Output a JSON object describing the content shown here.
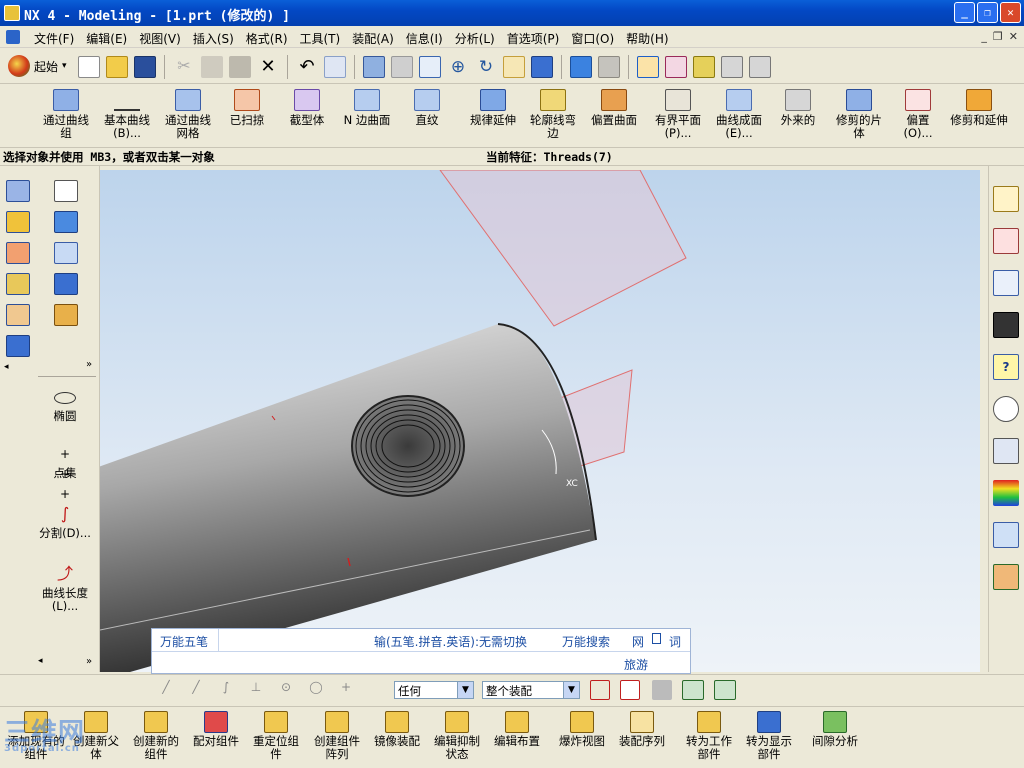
{
  "window": {
    "title": "NX 4 - Modeling - [1.prt  (修改的) ]"
  },
  "menubar": {
    "items": [
      "文件(F)",
      "编辑(E)",
      "视图(V)",
      "插入(S)",
      "格式(R)",
      "工具(T)",
      "装配(A)",
      "信息(I)",
      "分析(L)",
      "首选项(P)",
      "窗口(O)",
      "帮助(H)"
    ]
  },
  "toolbar1": {
    "start_label": "起始",
    "start_arrow": "▾"
  },
  "toolbar2": {
    "buttons": [
      {
        "label": "通过曲线组",
        "icon": "through-curves-icon"
      },
      {
        "label": "基本曲线(B)...",
        "icon": "basic-curves-icon"
      },
      {
        "label": "通过曲线网格",
        "icon": "curve-mesh-icon"
      },
      {
        "label": "已扫掠",
        "icon": "swept-icon"
      },
      {
        "label": "截型体",
        "icon": "section-body-icon"
      },
      {
        "label": "N 边曲面",
        "icon": "n-sided-surface-icon"
      },
      {
        "label": "直纹",
        "icon": "ruled-icon"
      },
      {
        "label": "规律延伸",
        "icon": "law-extension-icon"
      },
      {
        "label": "轮廓线弯边",
        "icon": "profile-flange-icon"
      },
      {
        "label": "偏置曲面",
        "icon": "offset-surface-icon"
      },
      {
        "label": "有界平面(P)...",
        "icon": "bounded-plane-icon"
      },
      {
        "label": "曲线成面(E)...",
        "icon": "curves-to-face-icon"
      },
      {
        "label": "外来的",
        "icon": "foreign-icon"
      },
      {
        "label": "修剪的片体",
        "icon": "trimmed-sheet-icon"
      },
      {
        "label": "偏置(O)...",
        "icon": "offset-icon"
      },
      {
        "label": "修剪和延伸",
        "icon": "trim-extend-icon"
      }
    ]
  },
  "status": {
    "prompt": "选择对象并使用 MB3，或者双击某一对象",
    "current_feature": "当前特征：Threads(7)"
  },
  "left_toolbar": {
    "curve_buttons": [
      {
        "label": "椭圆",
        "icon": "ellipse-icon"
      },
      {
        "label": "点集",
        "icon": "point-set-icon"
      },
      {
        "label": "分割(D)...",
        "icon": "divide-curve-icon"
      },
      {
        "label": "曲线长度(L)...",
        "icon": "curve-length-icon"
      }
    ]
  },
  "viewport": {
    "csys_label": "XC"
  },
  "ime": {
    "name": "万能五笔",
    "mode": "输(五笔.拼音.英语):无需切换",
    "search": "万能搜索",
    "links": [
      "网",
      "词"
    ],
    "tour": "旅游"
  },
  "selection": {
    "filter": "任何",
    "scope": "整个装配"
  },
  "bottom_toolbar": {
    "buttons": [
      {
        "label": "添加现有的组件",
        "icon": "add-component-icon"
      },
      {
        "label": "创建新父体",
        "icon": "new-parent-icon"
      },
      {
        "label": "创建新的组件",
        "icon": "new-component-icon"
      },
      {
        "label": "配对组件",
        "icon": "mate-component-icon"
      },
      {
        "label": "重定位组件",
        "icon": "reposition-icon"
      },
      {
        "label": "创建组件阵列",
        "icon": "component-array-icon"
      },
      {
        "label": "镜像装配",
        "icon": "mirror-assembly-icon"
      },
      {
        "label": "编辑抑制状态",
        "icon": "edit-suppression-icon"
      },
      {
        "label": "编辑布置",
        "icon": "edit-arrangement-icon"
      },
      {
        "label": "爆炸视图",
        "icon": "exploded-view-icon"
      },
      {
        "label": "装配序列",
        "icon": "assembly-sequence-icon"
      },
      {
        "label": "转为工作部件",
        "icon": "make-work-part-icon"
      },
      {
        "label": "转为显示部件",
        "icon": "make-display-part-icon"
      },
      {
        "label": "间隙分析",
        "icon": "clearance-analysis-icon"
      }
    ]
  },
  "watermark": {
    "text": "三维网",
    "sub": "3dportal.cn"
  }
}
